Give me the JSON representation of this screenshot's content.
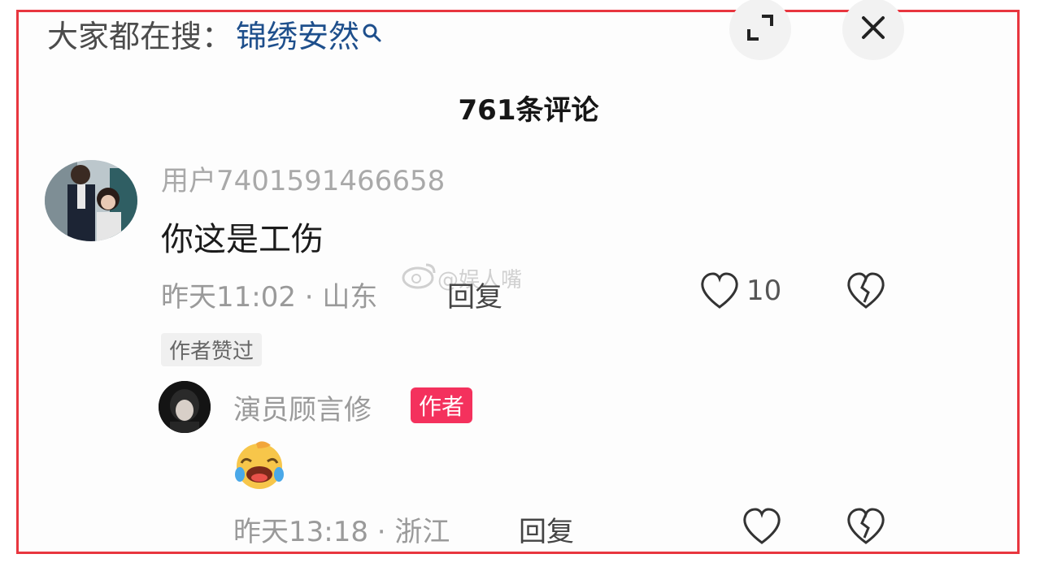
{
  "search": {
    "prefix": "大家都在搜：",
    "keyword": "锦绣安然"
  },
  "comments_header": {
    "title": "761条评论"
  },
  "comment": {
    "username": "用户7401591466658",
    "text": "你这是工伤",
    "meta": "昨天11:02 · 山东",
    "reply_label": "回复",
    "like_count": "10",
    "author_liked_label": "作者赞过"
  },
  "reply": {
    "username": "演员顾言修",
    "author_badge": "作者",
    "meta": "昨天13:18 · 浙江",
    "reply_label": "回复"
  },
  "watermark": {
    "text": "@娱人嘴"
  },
  "colors": {
    "frame_border": "#e8363f",
    "keyword": "#1e4f8c",
    "author_badge": "#f4315d"
  }
}
